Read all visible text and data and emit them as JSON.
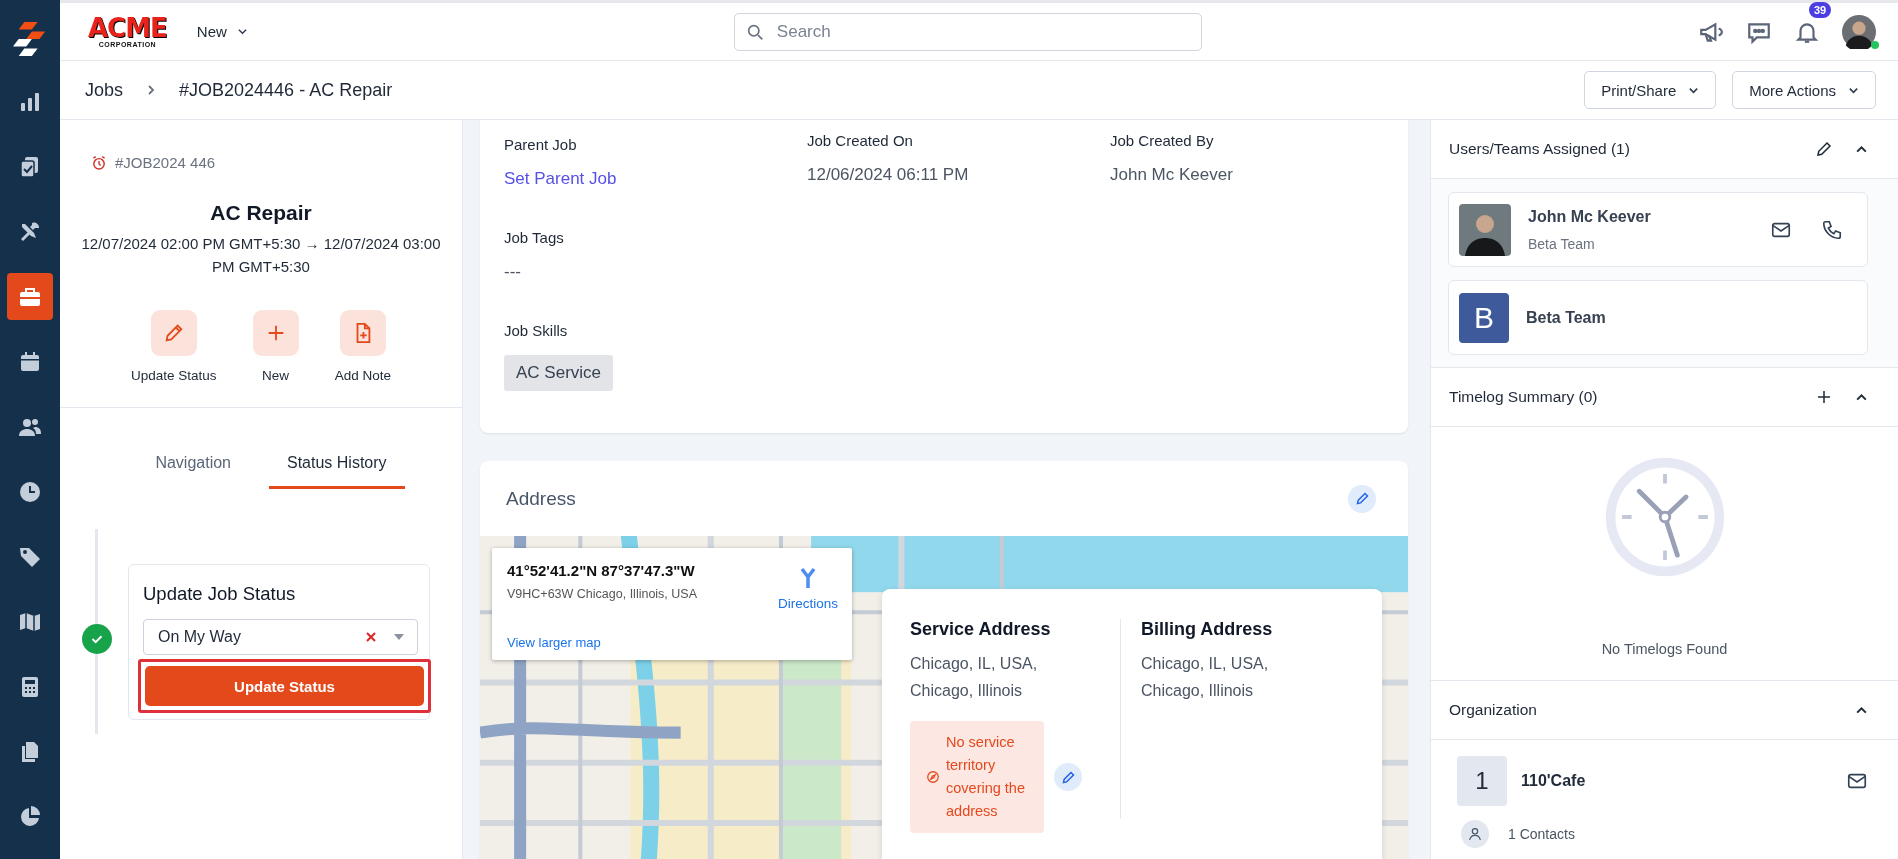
{
  "sidebar": {
    "items": [
      {
        "selected": false
      },
      {
        "selected": false
      },
      {
        "selected": false
      },
      {
        "selected": true
      },
      {
        "selected": false
      },
      {
        "selected": false
      },
      {
        "selected": false
      },
      {
        "selected": false
      },
      {
        "selected": false
      },
      {
        "selected": false
      },
      {
        "selected": false
      },
      {
        "selected": false
      }
    ]
  },
  "header": {
    "logo": "ACME",
    "logo_sub": "CORPORATION",
    "new_menu": "New",
    "search": {
      "placeholder": "Search"
    },
    "notifications": "39",
    "user_online": true
  },
  "breadcrumb": [
    "Jobs",
    "#JOB2024446 - AC Repair"
  ],
  "actions": [
    "Print/Share",
    "More Actions"
  ],
  "job": {
    "number": "#JOB2024 446",
    "title": "AC Repair",
    "schedule": "12/07/2024 02:00 PM GMT+5:30 → 12/07/2024 03:00 PM GMT+5:30",
    "quick_actions": [
      {
        "kind": "edit",
        "label": "Update Status"
      },
      {
        "kind": "add",
        "label": "New"
      },
      {
        "kind": "note",
        "label": "Add Note"
      }
    ]
  },
  "tabs": [
    {
      "label": "Navigation",
      "selected": false
    },
    {
      "label": "Status History",
      "selected": true
    }
  ],
  "status_update": {
    "done": true,
    "title": "Update Job Status",
    "value": "On My Way",
    "button": "Update Status",
    "highlighted": true
  },
  "details": {
    "fields": [
      {
        "label": "Parent Job",
        "value": "Set Parent Job",
        "kind": "link"
      },
      {
        "label": "Job Created On",
        "value": "12/06/2024 06:11 PM",
        "kind": "text"
      },
      {
        "label": "Job Created By",
        "value": "John Mc Keever",
        "kind": "text"
      },
      {
        "label": "Job Tags",
        "value": "---",
        "kind": "text"
      },
      {
        "label": "Job Skills",
        "value": "AC Service",
        "kind": "chip"
      }
    ]
  },
  "address": {
    "title": "Address",
    "map_info": {
      "coords": "41°52'41.2\"N 87°37'47.3\"W",
      "plus_code": "V9HC+63W Chicago, Illinois, USA",
      "directions": "Directions",
      "larger_map": "View larger map"
    },
    "service": {
      "title": "Service Address",
      "lines": [
        "Chicago, IL, USA,",
        "Chicago, Illinois"
      ]
    },
    "billing": {
      "title": "Billing Address",
      "lines": [
        "Chicago, IL, USA,",
        "Chicago, Illinois"
      ]
    },
    "territory_warning": "No service territory covering the address"
  },
  "assigned": {
    "title": "Users/Teams Assigned (1)",
    "expanded": true,
    "members": [
      {
        "kind": "user",
        "name": "John Mc Keever",
        "team": "Beta Team"
      },
      {
        "kind": "team",
        "initial": "B",
        "name": "Beta Team"
      }
    ]
  },
  "timelog": {
    "title": "Timelog Summary (0)",
    "expanded": true,
    "empty": "No Timelogs Found"
  },
  "organization": {
    "title": "Organization",
    "expanded": true,
    "initial": "1",
    "name": "110'Cafe",
    "contacts": "1 Contacts"
  }
}
